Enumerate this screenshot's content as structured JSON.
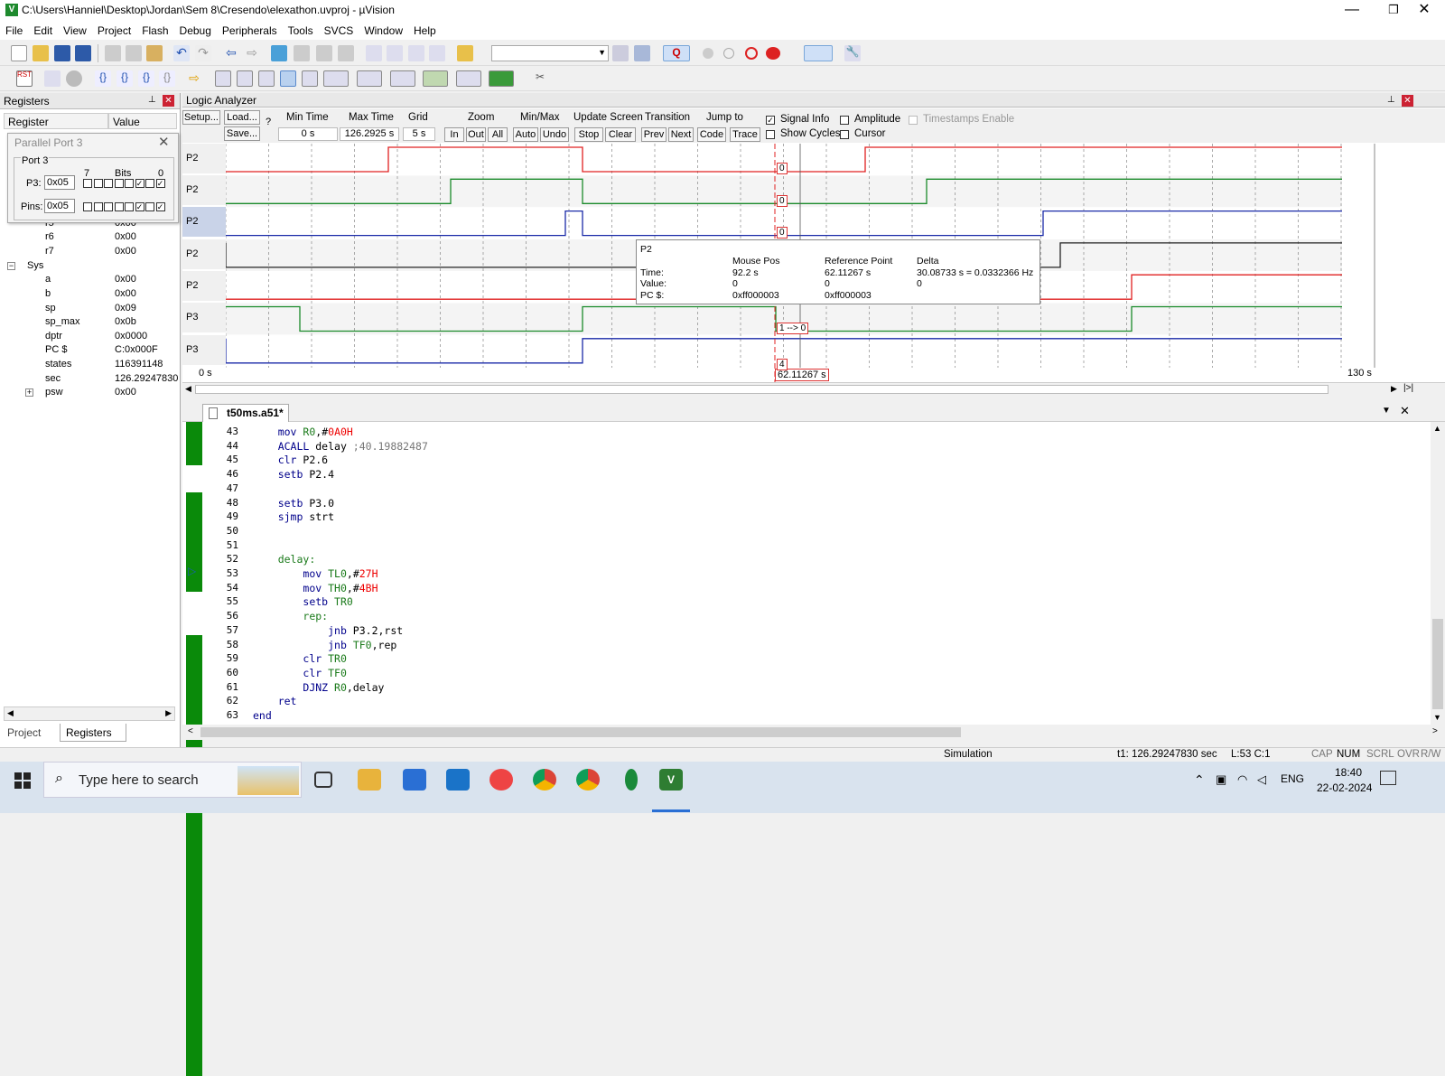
{
  "window": {
    "title": "C:\\Users\\Hanniel\\Desktop\\Jordan\\Sem 8\\Cresendo\\elexathon.uvproj - µVision",
    "minimize": "—",
    "maximize": "❐",
    "close": "✕"
  },
  "menu": [
    "File",
    "Edit",
    "View",
    "Project",
    "Flash",
    "Debug",
    "Peripherals",
    "Tools",
    "SVCS",
    "Window",
    "Help"
  ],
  "registers": {
    "title": "Registers",
    "col_register": "Register",
    "col_value": "Value",
    "rows": [
      {
        "name": "r5",
        "value": "0x00"
      },
      {
        "name": "r6",
        "value": "0x00"
      },
      {
        "name": "r7",
        "value": "0x00"
      }
    ],
    "sys_label": "Sys",
    "sys_rows": [
      {
        "name": "a",
        "value": "0x00"
      },
      {
        "name": "b",
        "value": "0x00"
      },
      {
        "name": "sp",
        "value": "0x09"
      },
      {
        "name": "sp_max",
        "value": "0x0b"
      },
      {
        "name": "dptr",
        "value": "0x0000"
      },
      {
        "name": "PC  $",
        "value": "C:0x000F"
      },
      {
        "name": "states",
        "value": "116391148"
      },
      {
        "name": "sec",
        "value": "126.29247830"
      },
      {
        "name": "psw",
        "value": "0x00"
      }
    ],
    "tab_project": "Project",
    "tab_registers": "Registers"
  },
  "parallel_port": {
    "title": "Parallel Port 3",
    "group": "Port 3",
    "bits_label": "Bits",
    "bit_high": "7",
    "bit_low": "0",
    "p3_label": "P3:",
    "p3_value": "0x05",
    "pins_label": "Pins:",
    "pins_value": "0x05"
  },
  "logic_analyzer": {
    "title": "Logic Analyzer",
    "setup": "Setup...",
    "load": "Load...",
    "save": "Save...",
    "help": "?",
    "min_time_label": "Min Time",
    "min_time": "0 s",
    "max_time_label": "Max Time",
    "max_time": "126.2925 s",
    "grid_label": "Grid",
    "grid": "5 s",
    "zoom_label": "Zoom",
    "zoom_in": "In",
    "zoom_out": "Out",
    "zoom_all": "All",
    "minmax_label": "Min/Max",
    "auto": "Auto",
    "undo": "Undo",
    "update_label": "Update Screen",
    "stop": "Stop",
    "clear": "Clear",
    "transition_label": "Transition",
    "prev": "Prev",
    "next": "Next",
    "jump_label": "Jump to",
    "code": "Code",
    "trace": "Trace",
    "signal_info": "Signal Info",
    "show_cycles": "Show Cycles",
    "amplitude": "Amplitude",
    "cursor": "Cursor",
    "timestamps": "Timestamps Enable",
    "signals": [
      "P2",
      "P2",
      "P2",
      "P2",
      "P2",
      "P3",
      "P3"
    ],
    "axis_start": "0 s",
    "axis_end": "130 s",
    "cursor_time": "62.11267 s",
    "markers": [
      "0",
      "0",
      "0",
      "1 --> 0",
      "4"
    ],
    "tooltip": {
      "signal": "P2",
      "col_mouse": "Mouse Pos",
      "col_ref": "Reference Point",
      "col_delta": "Delta",
      "row_time": "Time:",
      "row_value": "Value:",
      "row_pc": "PC $:",
      "mouse_time": "92.2 s",
      "mouse_value": "0",
      "mouse_pc": "0xff000003",
      "ref_time": "62.11267 s",
      "ref_value": "0",
      "ref_pc": "0xff000003",
      "delta_time": "30.08733 s = 0.0332366 Hz",
      "delta_value": "0"
    }
  },
  "editor": {
    "tab": "t50ms.a51*",
    "lines": [
      {
        "n": "43",
        "t": "    mov R0,#0A0H"
      },
      {
        "n": "44",
        "t": "    ACALL delay ;40.19882487"
      },
      {
        "n": "45",
        "t": "    clr P2.6"
      },
      {
        "n": "46",
        "t": "    setb P2.4"
      },
      {
        "n": "47",
        "t": ""
      },
      {
        "n": "48",
        "t": "    setb P3.0"
      },
      {
        "n": "49",
        "t": "    sjmp strt"
      },
      {
        "n": "50",
        "t": ""
      },
      {
        "n": "51",
        "t": ""
      },
      {
        "n": "52",
        "t": "    delay:"
      },
      {
        "n": "53",
        "t": "        mov TL0,#27H"
      },
      {
        "n": "54",
        "t": "        mov TH0,#4BH"
      },
      {
        "n": "55",
        "t": "        setb TR0"
      },
      {
        "n": "56",
        "t": "        rep:"
      },
      {
        "n": "57",
        "t": "            jnb P3.2,rst"
      },
      {
        "n": "58",
        "t": "            jnb TF0,rep"
      },
      {
        "n": "59",
        "t": "        clr TR0"
      },
      {
        "n": "60",
        "t": "        clr TF0"
      },
      {
        "n": "61",
        "t": "        DJNZ R0,delay"
      },
      {
        "n": "62",
        "t": "    ret"
      },
      {
        "n": "63",
        "t": "end"
      }
    ]
  },
  "status": {
    "mode": "Simulation",
    "t1": "t1: 126.29247830 sec",
    "pos": "L:53 C:1",
    "cap": "CAP",
    "num": "NUM",
    "scrl": "SCRL",
    "ovr": "OVR",
    "rw": "R/W"
  },
  "taskbar": {
    "search_placeholder": "Type here to search",
    "lang": "ENG",
    "time": "18:40",
    "date": "22-02-2024"
  }
}
